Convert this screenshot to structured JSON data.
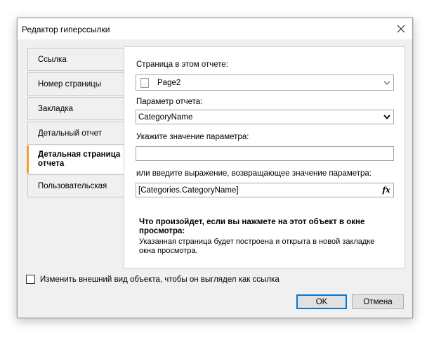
{
  "window": {
    "title": "Редактор гиперссылки"
  },
  "tabs": [
    {
      "label": "Ссылка",
      "active": false
    },
    {
      "label": "Номер страницы",
      "active": false
    },
    {
      "label": "Закладка",
      "active": false
    },
    {
      "label": "Детальный отчет",
      "active": false
    },
    {
      "label": "Детальная страница отчета",
      "active": true
    },
    {
      "label": "Пользовательская",
      "active": false
    }
  ],
  "panel": {
    "page_label": "Страница в этом отчете:",
    "page_value": "Page2",
    "param_label": "Параметр отчета:",
    "param_value": "CategoryName",
    "value_label": "Укажите значение параметра:",
    "value_value": "",
    "expr_label": "или введите выражение, возвращающее значение параметра:",
    "expr_value": "[Categories.CategoryName]",
    "fx_label": "fx",
    "info_title": "Что произойдет, если вы нажмете на этот объект в окне просмотра:",
    "info_body": "Указанная страница будет построена и открыта в новой закладке окна просмотра."
  },
  "checkbox": {
    "label": "Изменить внешний вид объекта, чтобы он выглядел как ссылка",
    "checked": false
  },
  "buttons": {
    "ok": "OK",
    "cancel": "Отмена"
  },
  "colors": {
    "accent_tab": "#f0a030",
    "default_button_border": "#0078d7"
  }
}
